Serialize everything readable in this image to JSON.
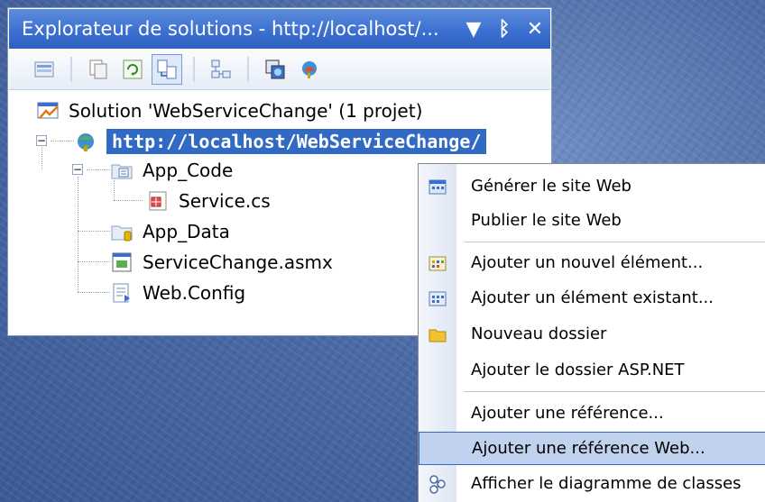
{
  "window": {
    "title": "Explorateur de solutions - http://localhost/...",
    "buttons": {
      "dropdown": "▼",
      "pin": "ᛒ",
      "close": "✕"
    }
  },
  "toolbar": {
    "icons": [
      "properties-icon",
      "show-all-files-icon",
      "refresh-icon",
      "nest-related-files-icon",
      "view-class-diagram-icon",
      "copy-website-icon",
      "asp-net-config-icon"
    ]
  },
  "tree": {
    "solution": "Solution 'WebServiceChange' (1 projet)",
    "project": "http://localhost/WebServiceChange/",
    "app_code": "App_Code",
    "service_cs": "Service.cs",
    "app_data": "App_Data",
    "asmx": "ServiceChange.asmx",
    "web_config": "Web.Config"
  },
  "context_menu": {
    "items": [
      {
        "label": "Générer le site Web",
        "icon": "build-icon"
      },
      {
        "label": "Publier le site Web",
        "icon": ""
      },
      {
        "label": "Ajouter un nouvel élément...",
        "icon": "new-item-icon"
      },
      {
        "label": "Ajouter un élément existant...",
        "icon": "existing-item-icon"
      },
      {
        "label": "Nouveau dossier",
        "icon": "folder-icon"
      },
      {
        "label": "Ajouter le dossier ASP.NET",
        "icon": ""
      },
      {
        "label": "Ajouter une référence...",
        "icon": ""
      },
      {
        "label": "Ajouter une référence Web...",
        "icon": "",
        "selected": true
      },
      {
        "label": "Afficher le diagramme de classes",
        "icon": "class-diagram-icon"
      }
    ]
  }
}
